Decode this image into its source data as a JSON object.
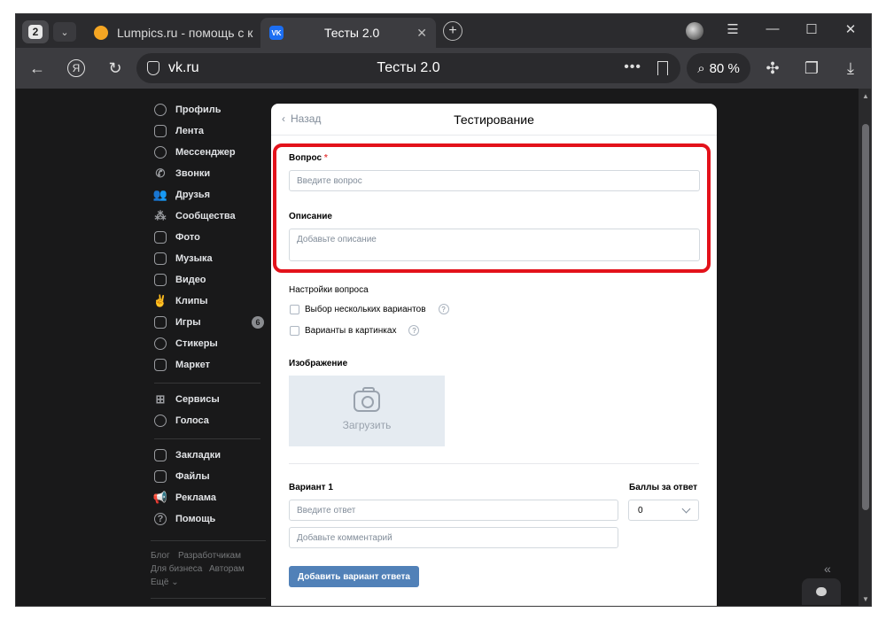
{
  "browser": {
    "tab_count": "2",
    "tabs": [
      {
        "title": "Lumpics.ru - помощь с ком",
        "favicon": "lumpics-favicon"
      },
      {
        "title": "Тесты 2.0",
        "favicon": "vk-favicon"
      }
    ],
    "address": {
      "domain": "vk.ru",
      "page_title": "Тесты 2.0",
      "dots": "•••"
    },
    "zoom": "80 %"
  },
  "sidebar": {
    "items": [
      {
        "label": "Профиль",
        "icon": "user-icon"
      },
      {
        "label": "Лента",
        "icon": "feed-icon"
      },
      {
        "label": "Мессенджер",
        "icon": "chat-bubble-icon"
      },
      {
        "label": "Звонки",
        "icon": "phone-icon"
      },
      {
        "label": "Друзья",
        "icon": "friends-icon"
      },
      {
        "label": "Сообщества",
        "icon": "communities-icon"
      },
      {
        "label": "Фото",
        "icon": "photo-icon"
      },
      {
        "label": "Музыка",
        "icon": "music-icon"
      },
      {
        "label": "Видео",
        "icon": "video-icon"
      },
      {
        "label": "Клипы",
        "icon": "clips-icon"
      },
      {
        "label": "Игры",
        "icon": "gamepad-icon",
        "badge": "6"
      },
      {
        "label": "Стикеры",
        "icon": "sticker-icon"
      },
      {
        "label": "Маркет",
        "icon": "market-bag-icon"
      },
      {
        "label": "Сервисы",
        "icon": "grid-icon"
      },
      {
        "label": "Голоса",
        "icon": "coins-icon"
      },
      {
        "label": "Закладки",
        "icon": "bookmark-icon"
      },
      {
        "label": "Файлы",
        "icon": "file-icon"
      },
      {
        "label": "Реклама",
        "icon": "megaphone-icon"
      },
      {
        "label": "Помощь",
        "icon": "help-circle-icon"
      }
    ],
    "footer": {
      "blog": "Блог",
      "developers": "Разработчикам",
      "business": "Для бизнеса",
      "authors": "Авторам",
      "more": "Ещё ⌄"
    }
  },
  "card": {
    "back_label": "Назад",
    "title": "Тестирование",
    "question_label": "Вопрос",
    "question_required": "*",
    "question_placeholder": "Введите вопрос",
    "description_label": "Описание",
    "description_placeholder": "Добавьте описание",
    "settings_title": "Настройки вопроса",
    "option_multiple": "Выбор нескольких вариантов",
    "option_images": "Варианты в картинках",
    "help_glyph": "?",
    "image_label": "Изображение",
    "upload_label": "Загрузить",
    "variant_label": "Вариант 1",
    "answer_placeholder": "Введите ответ",
    "comment_placeholder": "Добавьте комментарий",
    "points_label": "Баллы за ответ",
    "points_value": "0",
    "add_variant_button": "Добавить вариант ответа"
  },
  "colors": {
    "highlight": "#e3121b",
    "primary_button": "#5181b8"
  }
}
